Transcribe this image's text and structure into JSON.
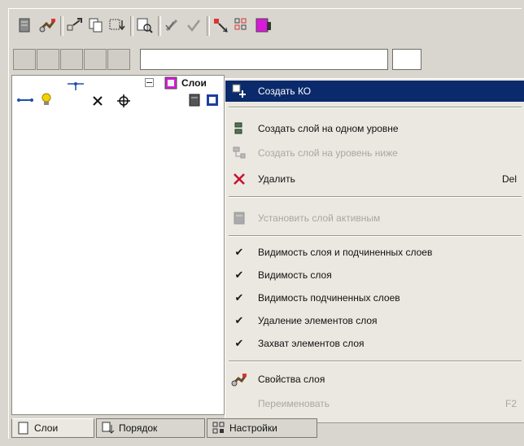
{
  "tree": {
    "root_label": "Слои"
  },
  "context_menu": {
    "items": [
      {
        "label": "Создать КО",
        "shortcut": "",
        "icon": "create-object-icon",
        "state": "selected"
      },
      {
        "label": "Создать слой на одном уровне",
        "shortcut": "",
        "icon": "layer-same-level-icon",
        "state": "enabled"
      },
      {
        "label": "Создать слой на уровень ниже",
        "shortcut": "",
        "icon": "layer-lower-level-icon",
        "state": "disabled"
      },
      {
        "label": "Удалить",
        "shortcut": "Del",
        "icon": "delete-icon",
        "state": "enabled"
      },
      {
        "label": "Установить слой активным",
        "shortcut": "",
        "icon": "set-active-layer-icon",
        "state": "disabled"
      },
      {
        "label": "Видимость слоя и подчиненных слоев",
        "shortcut": "",
        "icon": "check-icon",
        "state": "checked"
      },
      {
        "label": "Видимость слоя",
        "shortcut": "",
        "icon": "check-icon",
        "state": "checked"
      },
      {
        "label": "Видимость подчиненных слоев",
        "shortcut": "",
        "icon": "check-icon",
        "state": "checked"
      },
      {
        "label": "Удаление элементов слоя",
        "shortcut": "",
        "icon": "check-icon",
        "state": "checked"
      },
      {
        "label": "Захват элементов слоя",
        "shortcut": "",
        "icon": "check-icon",
        "state": "checked"
      },
      {
        "label": "Свойства слоя",
        "shortcut": "",
        "icon": "layer-properties-icon",
        "state": "enabled"
      },
      {
        "label": "Переименовать",
        "shortcut": "F2",
        "icon": "",
        "state": "disabled"
      }
    ]
  },
  "tabs": [
    {
      "label": "Слои",
      "icon": "layers-tab-icon",
      "active": true
    },
    {
      "label": "Порядок",
      "icon": "order-tab-icon",
      "active": false
    },
    {
      "label": "Настройки",
      "icon": "settings-tab-icon",
      "active": false
    }
  ],
  "colors": {
    "menu_highlight": "#0a2a6b",
    "panel_bg": "#d8d6cf",
    "menu_bg": "#ebe8e1",
    "delete_red": "#c8102e",
    "magenta": "#d81bd8"
  }
}
